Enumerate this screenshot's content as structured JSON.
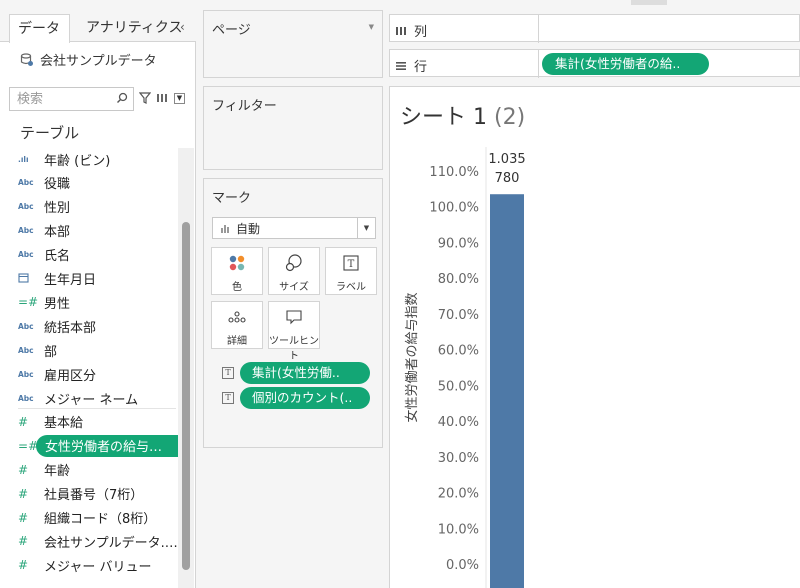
{
  "left_pane": {
    "tabs": [
      "データ",
      "アナリティクス"
    ],
    "collapse_glyph": "‹",
    "datasource": "会社サンプルデータ",
    "search_placeholder": "検索",
    "section_title": "テーブル",
    "fields": [
      {
        "icon": "bin-icon",
        "icon_text": ".ılı",
        "label": "年齢 (ビン)"
      },
      {
        "icon": "abc-icon",
        "icon_text": "Abc",
        "label": "役職"
      },
      {
        "icon": "abc-icon",
        "icon_text": "Abc",
        "label": "性別"
      },
      {
        "icon": "abc-icon",
        "icon_text": "Abc",
        "label": "本部"
      },
      {
        "icon": "abc-icon",
        "icon_text": "Abc",
        "label": "氏名"
      },
      {
        "icon": "calendar-icon",
        "icon_text": "",
        "label": "生年月日"
      },
      {
        "icon": "calc-icon",
        "icon_text": "=#",
        "label": "男性"
      },
      {
        "icon": "abc-icon",
        "icon_text": "Abc",
        "label": "統括本部"
      },
      {
        "icon": "abc-icon",
        "icon_text": "Abc",
        "label": "部"
      },
      {
        "icon": "abc-icon",
        "icon_text": "Abc",
        "label": "雇用区分"
      },
      {
        "icon": "abc-icon",
        "icon_text": "Abc",
        "label": "メジャー ネーム"
      },
      {
        "icon": "number-icon",
        "icon_text": "#",
        "label": "基本給"
      },
      {
        "icon": "calc-icon",
        "icon_text": "=#",
        "label": "女性労働者の給与…",
        "selected": true
      },
      {
        "icon": "number-icon",
        "icon_text": "#",
        "label": "年齢"
      },
      {
        "icon": "number-icon",
        "icon_text": "#",
        "label": "社員番号（7桁）"
      },
      {
        "icon": "number-icon",
        "icon_text": "#",
        "label": "組織コード（8桁）"
      },
      {
        "icon": "number-icon",
        "icon_text": "#",
        "label": "会社サンプルデータ.…"
      },
      {
        "icon": "number-icon",
        "icon_text": "#",
        "label": "メジャー バリュー"
      }
    ]
  },
  "pages_card": {
    "title": "ページ"
  },
  "filters_card": {
    "title": "フィルター"
  },
  "marks_card": {
    "title": "マーク",
    "mark_type": "自動",
    "buttons": [
      {
        "id": "color",
        "label": "色"
      },
      {
        "id": "size",
        "label": "サイズ"
      },
      {
        "id": "label",
        "label": "ラベル"
      },
      {
        "id": "detail",
        "label": "詳細"
      },
      {
        "id": "tooltip",
        "label": "ツールヒント"
      }
    ],
    "pills": [
      "集計(女性労働..",
      "個別のカウント(.."
    ]
  },
  "columns_shelf": {
    "label": "列"
  },
  "rows_shelf": {
    "label": "行",
    "pill": "集計(女性労働者の給.."
  },
  "sheet": {
    "title": "シート 1",
    "suffix": "(2)"
  },
  "colors": {
    "pill": "#13a675",
    "bar": "#4e79a7",
    "accent_blue": "#4e79a7"
  },
  "chart_data": {
    "type": "bar",
    "categories": [
      ""
    ],
    "values": [
      1.035
    ],
    "data_labels": [
      "1.035",
      "780"
    ],
    "ylabel": "女性労働者の給与指数",
    "ylim": [
      0,
      1.1
    ],
    "yticks": [
      "0.0%",
      "10.0%",
      "20.0%",
      "30.0%",
      "40.0%",
      "50.0%",
      "60.0%",
      "70.0%",
      "80.0%",
      "90.0%",
      "100.0%",
      "110.0%"
    ],
    "grid": false
  }
}
